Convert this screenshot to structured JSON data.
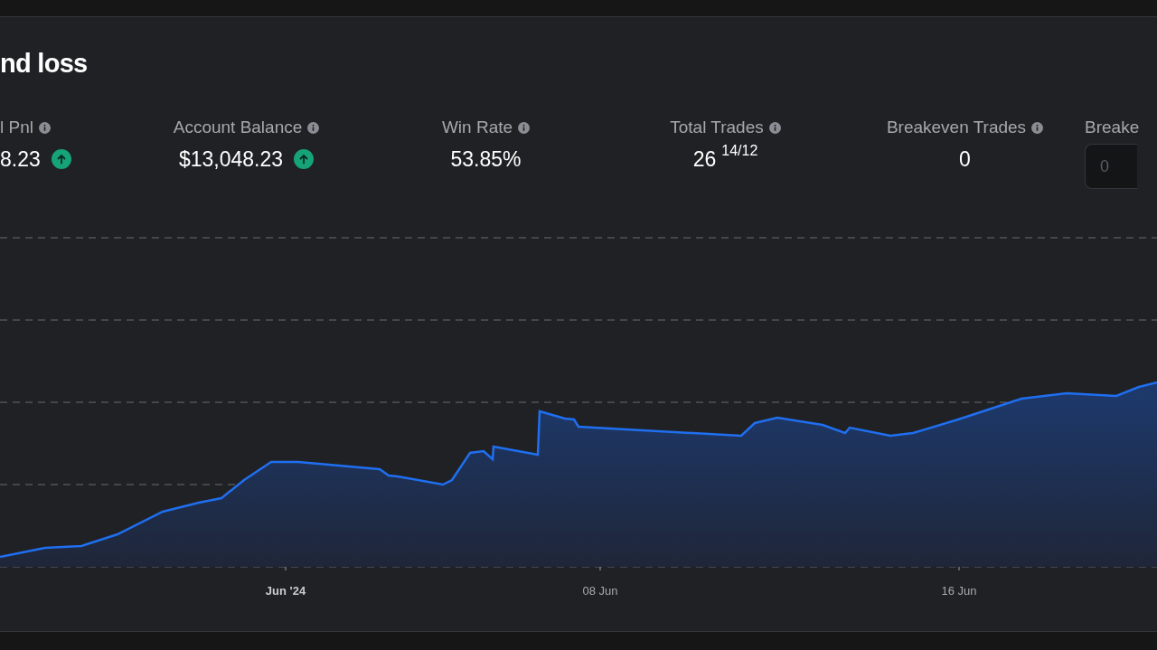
{
  "card": {
    "title": "nd loss",
    "stats": [
      {
        "kind": "value",
        "label": "l Pnl",
        "value": "8.23",
        "trend_up": true
      },
      {
        "kind": "value",
        "label": "Account Balance",
        "value": "$13,048.23",
        "trend_up": true
      },
      {
        "kind": "value",
        "label": "Win Rate",
        "value": "53.85%",
        "trend_up": false
      },
      {
        "kind": "value",
        "label": "Total Trades",
        "value": "26",
        "detail": "14/12",
        "trend_up": false
      },
      {
        "kind": "value",
        "label": "Breakeven Trades",
        "value": "0",
        "trend_up": false
      },
      {
        "kind": "input",
        "label": "Breake",
        "placeholder": "0"
      }
    ],
    "chart": {
      "x_labels": [
        {
          "label": "Jun '24",
          "major": true
        },
        {
          "label": "08 Jun",
          "major": false
        },
        {
          "label": "16 Jun",
          "major": false
        }
      ]
    }
  }
}
